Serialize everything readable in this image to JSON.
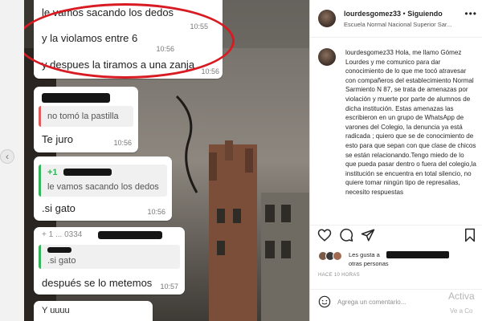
{
  "chat": {
    "messages": [
      {
        "text": "le vamos sacando los dedos",
        "time": "10:55"
      },
      {
        "text": "y la violamos entre 6",
        "time": "10:56"
      },
      {
        "text": "y despues la tiramos a una zanja",
        "time": "10:56"
      },
      {
        "quote": "no tomó la pastilla",
        "text": "Te juro",
        "time": "10:56"
      },
      {
        "quote_prefix": "+1",
        "quote": "le vamos sacando los dedos",
        "text": ".si gato",
        "time": "10:56"
      },
      {
        "header": "+ 1 ... 0334",
        "quote": ".si gato",
        "text": "después se lo metemos",
        "time": "10:57"
      },
      {
        "text": "Y uuuu"
      }
    ]
  },
  "post": {
    "username": "lourdesgomez33",
    "separator": "•",
    "follow_label": "Siguiendo",
    "subtitle": "Escuela Normal Nacional Superior Sar...",
    "more_label": "•••",
    "caption_user": "lourdesgomez33",
    "caption_text": "Hola, me llamo Gómez Lourdes y me comunico para dar conocimiento de lo que me tocó atravesar con compañeros del establecimiento Normal Sarmiento N 87, se trata de amenazas por violación y muerte por parte de alumnos de dicha institución. Estas amenazas las escribieron en un grupo de WhatsApp de varones del Colegio, la denuncia ya está radicada ; quiero que se de conocimiento de esto para que sepan con que clase de chicos se están relacionando.Tengo miedo de lo que pueda pasar dentro o fuera del colegio,la institución se encuentra en total silencio, no quiere tomar ningún tipo de represalias, necesito respuestas",
    "likes_prefix": "Les gusta a",
    "likes_suffix": "otras personas",
    "time_ago": "HACE 10 HORAS",
    "comment_placeholder": "Agrega un comentario..."
  },
  "icons": {
    "like": "heart-icon",
    "comment": "comment-icon",
    "share": "send-icon",
    "save": "bookmark-icon",
    "emoji": "smiley-icon",
    "prev": "chevron-left-icon"
  },
  "watermark": {
    "line1": "Activa",
    "line2": "Ve a Co"
  },
  "colors": {
    "circle": "#d81b23",
    "quote_red": "#e05b5b",
    "quote_green": "#35b35b"
  }
}
